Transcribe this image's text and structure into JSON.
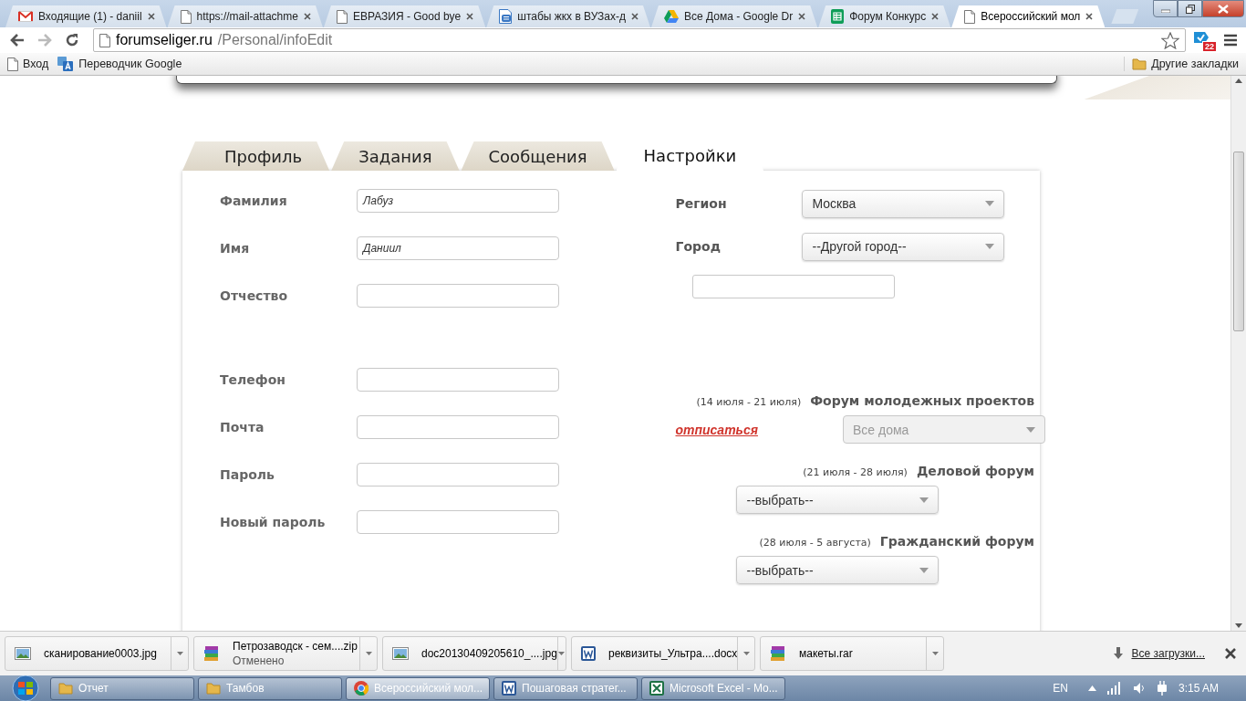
{
  "browser": {
    "tabs": [
      {
        "title": "Входящие (1) - daniil",
        "kind": "gmail",
        "selected": false
      },
      {
        "title": "https://mail-attachme",
        "kind": "page",
        "selected": false
      },
      {
        "title": "ЕВРАЗИЯ - Good bye",
        "kind": "page",
        "selected": false
      },
      {
        "title": "штабы жкх в ВУЗах-д",
        "kind": "docs",
        "selected": false
      },
      {
        "title": "Все Дома - Google Dr",
        "kind": "drive",
        "selected": false
      },
      {
        "title": "Форум Конкурс",
        "kind": "sheets",
        "selected": false
      },
      {
        "title": "Всероссийский мол",
        "kind": "page",
        "selected": true
      }
    ],
    "address": {
      "host": "forumseliger.ru",
      "path": "/Personal/infoEdit"
    },
    "extension_badge": "22",
    "bookmarks": [
      {
        "label": "Вход",
        "kind": "page"
      },
      {
        "label": "Переводчик Google",
        "kind": "translate"
      }
    ],
    "other_bookmarks": "Другие закладки"
  },
  "page": {
    "tabs": [
      {
        "label": "Профиль",
        "selected": false
      },
      {
        "label": "Задания",
        "selected": false
      },
      {
        "label": "Сообщения",
        "selected": false
      },
      {
        "label": "Настройки",
        "selected": true
      }
    ],
    "personal": [
      {
        "label": "Фамилия",
        "value": "Лабуз"
      },
      {
        "label": "Имя",
        "value": "Даниил"
      },
      {
        "label": "Отчество"
      }
    ],
    "contacts": [
      {
        "label": "Телефон"
      },
      {
        "label": "Почта"
      },
      {
        "label": "Пароль"
      },
      {
        "label": "Новый пароль"
      }
    ],
    "region": {
      "label": "Регион",
      "value": "Москва"
    },
    "city": {
      "label": "Город",
      "value": "--Другой город--"
    },
    "forums": [
      {
        "dates": "(14 июля - 21 июля)",
        "title": "Форум молодежных проектов",
        "unsubscribe": "отписаться",
        "choice": "Все дома",
        "disabled": true
      },
      {
        "dates": "(21 июля - 28 июля)",
        "title": "Деловой форум",
        "choice": "--выбрать--",
        "disabled": false
      },
      {
        "dates": "(28 июля - 5 августа)",
        "title": "Гражданский форум",
        "choice": "--выбрать--",
        "disabled": false
      }
    ]
  },
  "downloads": {
    "items": [
      {
        "name": "сканирование0003.jpg",
        "kind": "image"
      },
      {
        "name": "Петрозаводск - сем....zip",
        "status": "Отменено",
        "kind": "archive"
      },
      {
        "name": "doc20130409205610_....jpg",
        "kind": "image"
      },
      {
        "name": "реквизиты_Ультра....docx",
        "kind": "word"
      },
      {
        "name": "макеты.rar",
        "kind": "archive"
      }
    ],
    "all_link": "Все загрузки..."
  },
  "taskbar": {
    "items": [
      {
        "label": "Отчет",
        "kind": "folder",
        "selected": false
      },
      {
        "label": "Тамбов",
        "kind": "folder",
        "selected": false
      },
      {
        "label": "Всероссийский мол...",
        "kind": "chrome",
        "selected": true
      },
      {
        "label": "Пошаговая стратег...",
        "kind": "word",
        "selected": false
      },
      {
        "label": "Microsoft Excel - Mo...",
        "kind": "excel",
        "selected": false
      }
    ],
    "language": "EN",
    "clock": "3:15 AM"
  }
}
